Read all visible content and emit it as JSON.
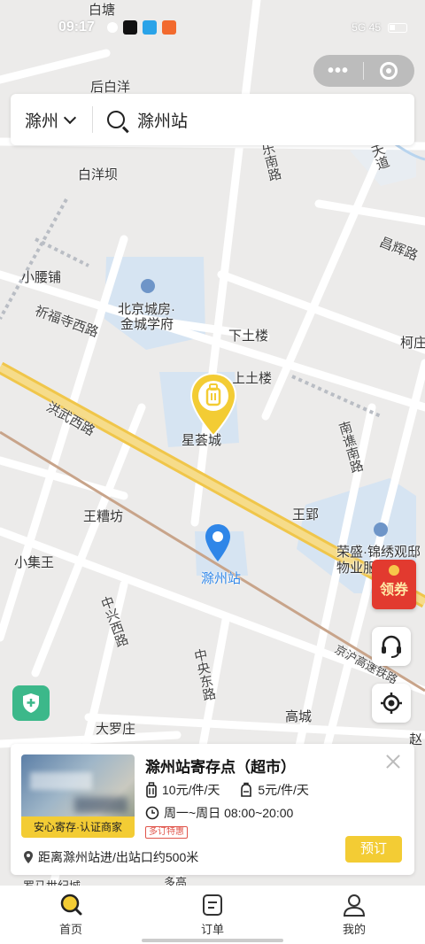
{
  "status_bar": {
    "time": "09:17",
    "right_text": "5G 45"
  },
  "search": {
    "city": "滁州",
    "query": "滁州站"
  },
  "map": {
    "places": [
      "白塘",
      "后白洋",
      "白洋坝",
      "小腰铺",
      "北京城房·",
      "金城学府",
      "下土楼",
      "上土楼",
      "柯庄",
      "星荟城",
      "王糟坊",
      "王郢",
      "荣盛·锦绣观邸",
      "物业服务中心",
      "小集王",
      "滁州站",
      "大罗庄",
      "高城",
      "赵",
      "罗马世纪城",
      "多高"
    ],
    "roads": [
      "乐南路",
      "天道",
      "昌辉路",
      "祈福寺西路",
      "洪武西路",
      "南谯南路",
      "中兴西路",
      "中央东路",
      "京沪高速铁路"
    ]
  },
  "coupon": {
    "label": "领券"
  },
  "store": {
    "name": "滁州站寄存点（超市）",
    "trusted_tag": "安心寄存·认证商家",
    "price_large": "10元/件/天",
    "price_small": "5元/件/天",
    "hours": "周一~周日 08:00~20:00",
    "promo_tag": "多订特惠",
    "distance": "距离滁州站进/出站口约500米",
    "book_label": "预订"
  },
  "tabs": [
    {
      "label": "首页",
      "active": true
    },
    {
      "label": "订单",
      "active": false
    },
    {
      "label": "我的",
      "active": false
    }
  ],
  "colors": {
    "accent": "#f3cc34",
    "pin_blue": "#2f86e8",
    "shield_green": "#3cb88a",
    "coupon_red": "#e23a2f"
  }
}
